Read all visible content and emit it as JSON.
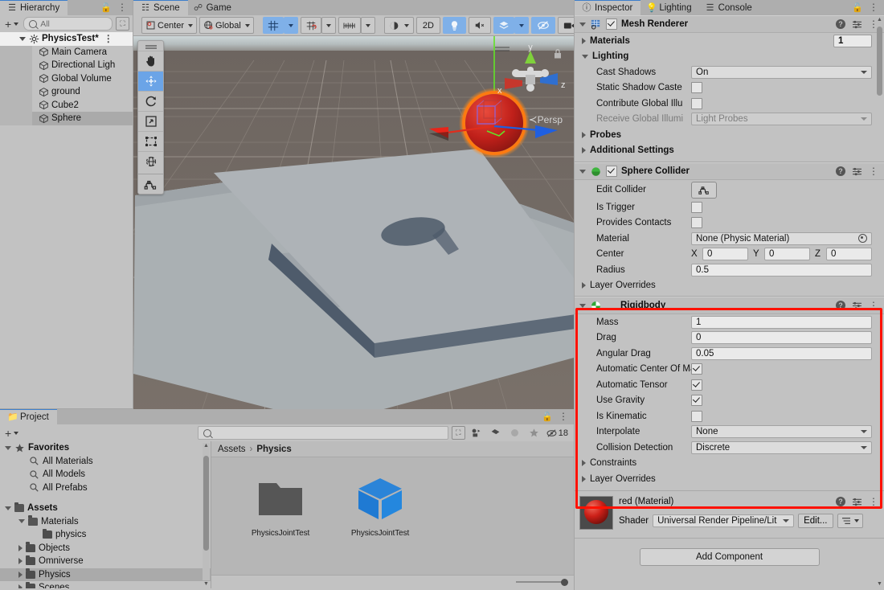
{
  "hierarchy": {
    "tab_label": "Hierarchy",
    "tab_icon": "list-icon",
    "search_placeholder": "All",
    "search_value": "",
    "scene_name": "PhysicsTest*",
    "items": [
      {
        "label": "Main Camera",
        "selected": false
      },
      {
        "label": "Directional Ligh",
        "selected": false
      },
      {
        "label": "Global Volume",
        "selected": false
      },
      {
        "label": "ground",
        "selected": false
      },
      {
        "label": "Cube2",
        "selected": false
      },
      {
        "label": "Sphere",
        "selected": true
      }
    ]
  },
  "scene": {
    "tabs": [
      {
        "label": "Scene",
        "icon": "grid-icon",
        "active": true
      },
      {
        "label": "Game",
        "icon": "gamepad-icon",
        "active": false
      }
    ],
    "toolbar": {
      "pivot_label": "Center",
      "space_label": "Global",
      "two_d_label": "2D",
      "grid_snap_icon": "grid-snap-icon",
      "magnet_snap_icon": "magnet-snap-icon",
      "layout_snap_icon": "ruler-icon",
      "shading_icon": "shading-mode-icon",
      "light_icon": "scene-lighting-icon",
      "audio_icon": "scene-audio-icon",
      "fx_icon": "effects-icon",
      "hidden_icon": "visibility-toggle-icon",
      "camera_icon": "scene-camera-icon"
    },
    "view_tools": [
      {
        "name": "hand-tool",
        "active": false
      },
      {
        "name": "move-tool",
        "active": true
      },
      {
        "name": "rotate-tool",
        "active": false
      },
      {
        "name": "scale-tool",
        "active": false
      },
      {
        "name": "rect-tool",
        "active": false
      },
      {
        "name": "transform-tool",
        "active": false
      },
      {
        "name": "custom-editor-tool",
        "active": false
      }
    ],
    "gizmo": {
      "axis_x": "x",
      "axis_y": "y",
      "axis_z": "z",
      "projection_label": "Persp"
    }
  },
  "project": {
    "tab_label": "Project",
    "search_value": "",
    "breadcrumb": [
      "Assets",
      "Physics"
    ],
    "hidden_count": "18",
    "tree": [
      {
        "label": "Favorites",
        "depth": 0,
        "icon": "star-icon",
        "expanded": true,
        "bold": true,
        "selected": false
      },
      {
        "label": "All Materials",
        "depth": 1,
        "icon": "search-icon",
        "bold": false,
        "selected": false
      },
      {
        "label": "All Models",
        "depth": 1,
        "icon": "search-icon",
        "bold": false,
        "selected": false
      },
      {
        "label": "All Prefabs",
        "depth": 1,
        "icon": "search-icon",
        "bold": false,
        "selected": false
      },
      {
        "label": "",
        "depth": 0,
        "icon": "spacer",
        "bold": false,
        "selected": false
      },
      {
        "label": "Assets",
        "depth": 0,
        "icon": "folder-icon",
        "expanded": true,
        "bold": true,
        "selected": false
      },
      {
        "label": "Materials",
        "depth": 1,
        "icon": "folder-icon",
        "expanded": true,
        "bold": false,
        "selected": false
      },
      {
        "label": "physics",
        "depth": 2,
        "icon": "folder-icon",
        "bold": false,
        "selected": false
      },
      {
        "label": "Objects",
        "depth": 1,
        "icon": "folder-icon",
        "collapsed": true,
        "bold": false,
        "selected": false
      },
      {
        "label": "Omniverse",
        "depth": 1,
        "icon": "folder-icon",
        "collapsed": true,
        "bold": false,
        "selected": false
      },
      {
        "label": "Physics",
        "depth": 1,
        "icon": "folder-icon",
        "collapsed": true,
        "bold": false,
        "selected": true
      },
      {
        "label": "Scenes",
        "depth": 1,
        "icon": "folder-icon",
        "collapsed": true,
        "bold": false,
        "selected": false
      }
    ],
    "assets": [
      {
        "label": "PhysicsJointTest",
        "kind": "folder"
      },
      {
        "label": "PhysicsJointTest",
        "kind": "prefab"
      }
    ]
  },
  "inspector": {
    "tabs": [
      {
        "label": "Inspector",
        "icon": "info-icon",
        "active": true
      },
      {
        "label": "Lighting",
        "icon": "bulb-icon",
        "active": false
      },
      {
        "label": "Console",
        "icon": "console-icon",
        "active": false
      }
    ],
    "mesh_renderer": {
      "title": "Mesh Renderer",
      "enabled": true,
      "materials_label": "Materials",
      "materials_count": "1",
      "lighting_label": "Lighting",
      "cast_shadows_label": "Cast Shadows",
      "cast_shadows_value": "On",
      "static_shadow_label": "Static Shadow Caste",
      "static_shadow_checked": false,
      "contribute_gi_label": "Contribute Global Illu",
      "contribute_gi_checked": false,
      "receive_gi_label": "Receive Global Illumi",
      "receive_gi_value": "Light Probes",
      "probes_label": "Probes",
      "additional_label": "Additional Settings"
    },
    "sphere_collider": {
      "title": "Sphere Collider",
      "enabled": true,
      "edit_collider_label": "Edit Collider",
      "is_trigger_label": "Is Trigger",
      "is_trigger_checked": false,
      "provides_contacts_label": "Provides Contacts",
      "provides_contacts_checked": false,
      "material_label": "Material",
      "material_value": "None (Physic Material)",
      "center_label": "Center",
      "center_x": "0",
      "center_y": "0",
      "center_z": "0",
      "axis_x": "X",
      "axis_y": "Y",
      "axis_z": "Z",
      "radius_label": "Radius",
      "radius_value": "0.5",
      "layer_overrides_label": "Layer Overrides"
    },
    "rigidbody": {
      "title": "Rigidbody",
      "highlighted": true,
      "highlight_color": "#ff1100",
      "mass_label": "Mass",
      "mass_value": "1",
      "drag_label": "Drag",
      "drag_value": "0",
      "angular_drag_label": "Angular Drag",
      "angular_drag_value": "0.05",
      "auto_center_label": "Automatic Center Of Ma",
      "auto_center_checked": true,
      "auto_tensor_label": "Automatic Tensor",
      "auto_tensor_checked": true,
      "use_gravity_label": "Use Gravity",
      "use_gravity_checked": true,
      "is_kinematic_label": "Is Kinematic",
      "is_kinematic_checked": false,
      "interpolate_label": "Interpolate",
      "interpolate_value": "None",
      "collision_detection_label": "Collision Detection",
      "collision_detection_value": "Discrete",
      "constraints_label": "Constraints",
      "layer_overrides_label": "Layer Overrides"
    },
    "material": {
      "title": "red (Material)",
      "shader_label": "Shader",
      "shader_value": "Universal Render Pipeline/Lit",
      "edit_label": "Edit...",
      "thumb_color": "#c41b16"
    },
    "add_component_label": "Add Component"
  }
}
